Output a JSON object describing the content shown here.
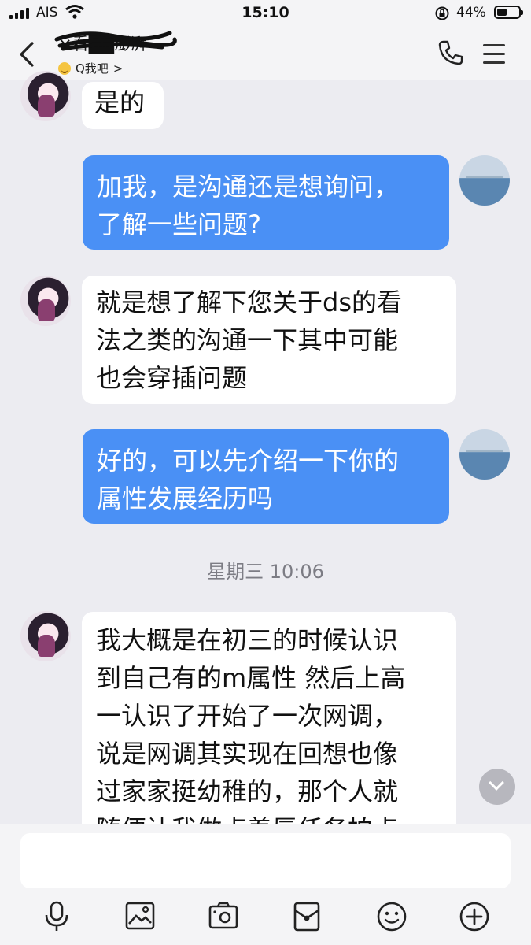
{
  "status_bar": {
    "carrier": "AIS",
    "time": "15:10",
    "battery_percent": "44%"
  },
  "header": {
    "chat_name": "×看██澎湃",
    "sub_label": "Q我吧",
    "sub_chevron": ">"
  },
  "messages": [
    {
      "side": "in",
      "text": "是的"
    },
    {
      "side": "out",
      "text": "加我，是沟通还是想询问，\n了解一些问题?"
    },
    {
      "side": "in",
      "text": "就是想了解下您关于ds的看\n法之类的沟通一下其中可能\n也会穿插问题"
    },
    {
      "side": "out",
      "text": "好的，可以先介绍一下你的\n属性发展经历吗"
    },
    {
      "side": "in",
      "text": "我大概是在初三的时候认识\n到自己有的m属性 然后上高\n一认识了开始了一次网调，\n说是网调其实现在回想也像\n过家家挺幼稚的，那个人就\n随便让我做点羞辱任务拍点"
    }
  ],
  "time_separator": "星期三 10:06",
  "input": {
    "placeholder": ""
  },
  "toolbar": [
    "mic-icon",
    "image-icon",
    "camera-icon",
    "red-packet-icon",
    "emoji-icon",
    "plus-icon"
  ],
  "colors": {
    "outgoing_bubble": "#4a90f5",
    "incoming_bubble": "#ffffff",
    "background": "#ececf1"
  }
}
